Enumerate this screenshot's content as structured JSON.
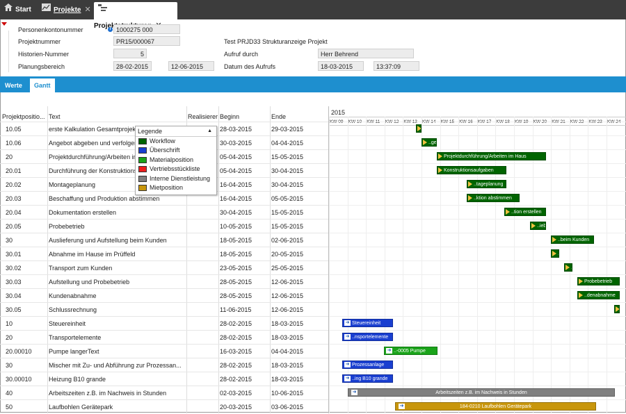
{
  "tabs": [
    {
      "label": "Start"
    },
    {
      "label": "Projekte"
    },
    {
      "label": "Projektstrukturen"
    }
  ],
  "form": {
    "personenkonto_label": "Personenkontonummer",
    "personenkonto_value": "1000275 000",
    "projektnummer_label": "Projektnummer",
    "projektnummer_value": "PR15/000067",
    "projekt_title": "Test PRJD33 Strukturanzeige Projekt",
    "historien_label": "Historien-Nummer",
    "historien_value": "5",
    "aufruf_label": "Aufruf durch",
    "aufruf_value": "Herr Behrend",
    "planung_label": "Planungsbereich",
    "planung_from": "28-02-2015",
    "planung_to": "12-06-2015",
    "datum_label": "Datum des Aufrufs",
    "datum_value": "18-03-2015",
    "zeit_value": "13:37:09"
  },
  "subtabs": {
    "werte": "Werte",
    "gantt": "Gantt"
  },
  "columns": {
    "pos": "Projektpositio...",
    "text": "Text",
    "real": "Realisierer",
    "begin": "Beginn",
    "end": "Ende"
  },
  "gantt": {
    "year": "2015",
    "weeks": [
      "KW 09",
      "KW 10",
      "KW 11",
      "KW 12",
      "KW 13",
      "KW 14",
      "KW 15",
      "KW 16",
      "KW 17",
      "KW 18",
      "KW 19",
      "KW 20",
      "KW 21",
      "KW 22",
      "KW 23",
      "KW 24"
    ]
  },
  "legend": {
    "title": "Legende",
    "items": [
      {
        "label": "Workflow",
        "color": "#006400"
      },
      {
        "label": "Überschrift",
        "color": "#1a3fd0"
      },
      {
        "label": "Materialposition",
        "color": "#1aa31a"
      },
      {
        "label": "Vertriebsstückliste",
        "color": "#ee1c1c"
      },
      {
        "label": "Interne Dienstleistung",
        "color": "#808080"
      },
      {
        "label": "Mietposition",
        "color": "#c8960c"
      }
    ]
  },
  "rows": [
    {
      "pos": "10.05",
      "text": "erste Kalkulation Gesamtprojekt",
      "begin": "28-03-2015",
      "end": "29-03-2015",
      "bar": ".."
    },
    {
      "pos": "10.06",
      "text": "Angebot abgeben und verfolgen",
      "begin": "30-03-2015",
      "end": "04-04-2015",
      "bar": "..gen"
    },
    {
      "pos": "20",
      "text": "Projektdurchführung/Arbeiten im Haus",
      "begin": "05-04-2015",
      "end": "15-05-2015",
      "bar": "Projektdurchführung/Arbeiten im Haus"
    },
    {
      "pos": "20.01",
      "text": "Durchführung der Konstruktionsaufgaben",
      "begin": "05-04-2015",
      "end": "30-04-2015",
      "bar": "Konstruktionsaufgaben"
    },
    {
      "pos": "20.02",
      "text": "Montageplanung",
      "begin": "16-04-2015",
      "end": "30-04-2015",
      "bar": "..tageplanung"
    },
    {
      "pos": "20.03",
      "text": "Beschaffung und Produktion abstimmen",
      "begin": "16-04-2015",
      "end": "05-05-2015",
      "bar": "..ktion abstimmen"
    },
    {
      "pos": "20.04",
      "text": "Dokumentation erstellen",
      "begin": "30-04-2015",
      "end": "15-05-2015",
      "bar": "..tion erstellen"
    },
    {
      "pos": "20.05",
      "text": "Probebetrieb",
      "begin": "10-05-2015",
      "end": "15-05-2015",
      "bar": "..ieb"
    },
    {
      "pos": "30",
      "text": "Auslieferung und Aufstellung beim Kunden",
      "begin": "18-05-2015",
      "end": "02-06-2015",
      "bar": "..beim Kunden"
    },
    {
      "pos": "30.01",
      "text": "Abnahme im Hause im Prüffeld",
      "begin": "18-05-2015",
      "end": "20-05-2015",
      "bar": "..d"
    },
    {
      "pos": "30.02",
      "text": "Transport zum Kunden",
      "begin": "23-05-2015",
      "end": "25-05-2015",
      "bar": "..n"
    },
    {
      "pos": "30.03",
      "text": "Aufstellung und Probebetrieb",
      "begin": "28-05-2015",
      "end": "12-06-2015",
      "bar": "Probebetrieb"
    },
    {
      "pos": "30.04",
      "text": "Kundenabnahme",
      "begin": "28-05-2015",
      "end": "12-06-2015",
      "bar": "..denabnahme"
    },
    {
      "pos": "30.05",
      "text": "Schlussrechnung",
      "begin": "11-06-2015",
      "end": "12-06-2015",
      "bar": ""
    },
    {
      "pos": "10",
      "text": "Steuereinheit",
      "begin": "28-02-2015",
      "end": "18-03-2015",
      "bar": "Steuereinheit"
    },
    {
      "pos": "20",
      "text": "Transportelemente",
      "begin": "28-02-2015",
      "end": "18-03-2015",
      "bar": "..nsportelemente"
    },
    {
      "pos": "20.00010",
      "text": "Pumpe langerText",
      "begin": "16-03-2015",
      "end": "04-04-2015",
      "bar": "..-0005 Pumpe"
    },
    {
      "pos": "30",
      "text": "Mischer mit Zu- und Abführung zur Prozessan...",
      "begin": "28-02-2015",
      "end": "18-03-2015",
      "bar": "Prozessanlage"
    },
    {
      "pos": "30.00010",
      "text": "Heizung B10 grande",
      "begin": "28-02-2015",
      "end": "18-03-2015",
      "bar": "..ing B10 grande"
    },
    {
      "pos": "40",
      "text": "Arbeitszeiten z.B. im Nachweis in Stunden",
      "begin": "02-03-2015",
      "end": "10-06-2015",
      "bar": "Arbeitszeiten z.B. im Nachweis in Stunden"
    },
    {
      "pos": "50",
      "text": "Laufbohlen Gerätepark",
      "begin": "20-03-2015",
      "end": "03-06-2015",
      "bar": "184-0210 Laufbohlen Gerätepark"
    }
  ]
}
